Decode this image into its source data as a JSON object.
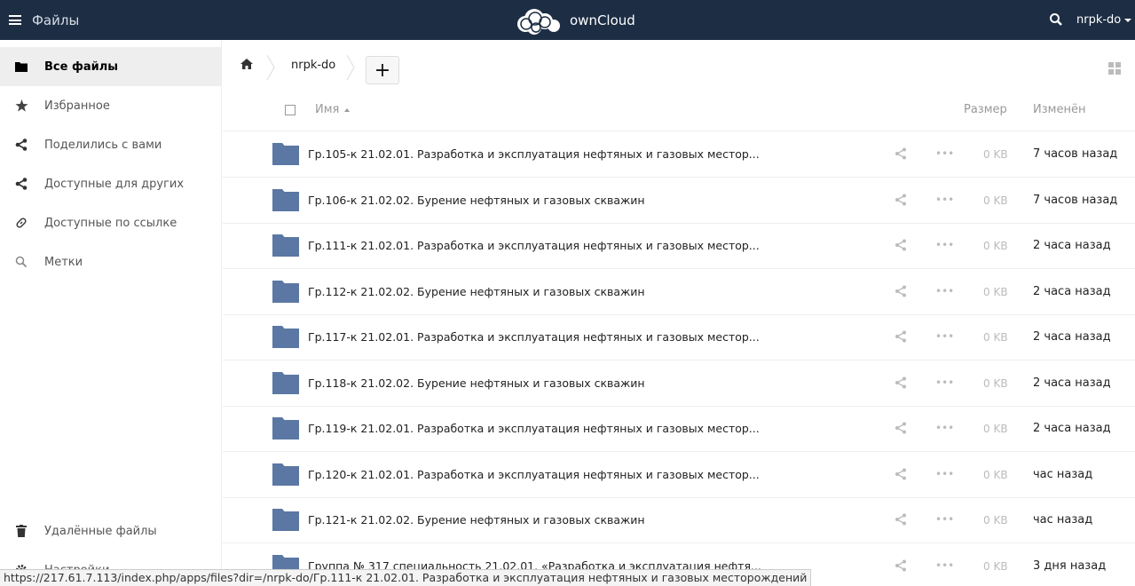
{
  "header": {
    "app_name": "Файлы",
    "logo_text": "ownCloud",
    "user": "nrpk-do"
  },
  "sidebar": {
    "items": [
      {
        "label": "Все файлы",
        "icon": "folder-icon"
      },
      {
        "label": "Избранное",
        "icon": "star-icon"
      },
      {
        "label": "Поделились с вами",
        "icon": "share-icon"
      },
      {
        "label": "Доступные для других",
        "icon": "share-icon"
      },
      {
        "label": "Доступные по ссылке",
        "icon": "link-icon"
      },
      {
        "label": "Метки",
        "icon": "search-icon"
      }
    ],
    "deleted": "Удалённые файлы",
    "settings": "Настройки"
  },
  "breadcrumb": {
    "folder": "nrpk-do",
    "add": "+"
  },
  "table": {
    "col_name": "Имя",
    "col_size": "Размер",
    "col_modified": "Изменён",
    "rows": [
      {
        "name": "Гр.105-к 21.02.01. Разработка и эксплуатация нефтяных и газовых местор...",
        "size": "0 KB",
        "modified": "7 часов назад"
      },
      {
        "name": "Гр.106-к 21.02.02. Бурение нефтяных и газовых скважин",
        "size": "0 KB",
        "modified": "7 часов назад"
      },
      {
        "name": "Гр.111-к 21.02.01. Разработка и эксплуатация нефтяных и газовых местор...",
        "size": "0 KB",
        "modified": "2 часа назад"
      },
      {
        "name": "Гр.112-к 21.02.02. Бурение нефтяных и газовых скважин",
        "size": "0 KB",
        "modified": "2 часа назад"
      },
      {
        "name": "Гр.117-к 21.02.01. Разработка и эксплуатация нефтяных и газовых местор...",
        "size": "0 KB",
        "modified": "2 часа назад"
      },
      {
        "name": "Гр.118-к 21.02.02. Бурение нефтяных и газовых скважин",
        "size": "0 KB",
        "modified": "2 часа назад"
      },
      {
        "name": "Гр.119-к 21.02.01. Разработка и эксплуатация нефтяных и газовых местор...",
        "size": "0 KB",
        "modified": "2 часа назад"
      },
      {
        "name": "Гр.120-к 21.02.01. Разработка и эксплуатация нефтяных и газовых местор...",
        "size": "0 KB",
        "modified": "час назад"
      },
      {
        "name": "Гр.121-к 21.02.02. Бурение нефтяных и газовых скважин",
        "size": "0 KB",
        "modified": "час назад"
      },
      {
        "name": "Группа № 317 специальность 21.02.01. «Разработка и эксплуатация нефтя...",
        "size": "0 KB",
        "modified": "3 дня назад"
      }
    ]
  },
  "status_url": "https://217.61.7.113/index.php/apps/files?dir=/nrpk-do/Гр.111-к  21.02.01. Разработка и эксплуатация нефтяных и газовых месторождений",
  "colors": {
    "header_bg": "#1d2d44",
    "folder": "#5b78a4"
  }
}
